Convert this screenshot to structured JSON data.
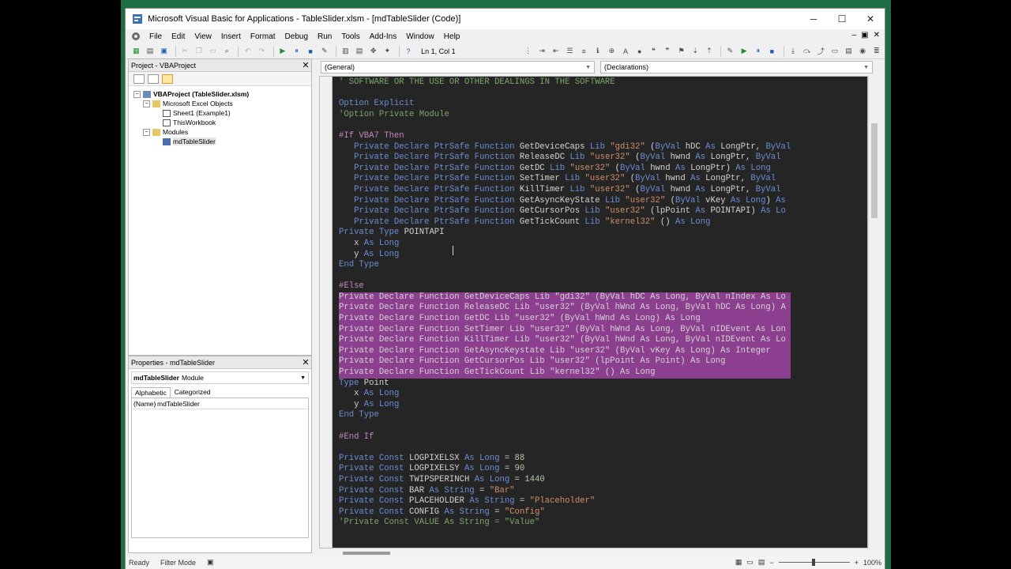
{
  "window": {
    "title": "Microsoft Visual Basic for Applications - TableSlider.xlsm - [mdTableSlider (Code)]",
    "minimize": "─",
    "maximize": "☐",
    "close": "✕"
  },
  "menu": [
    "File",
    "Edit",
    "View",
    "Insert",
    "Format",
    "Debug",
    "Run",
    "Tools",
    "Add-Ins",
    "Window",
    "Help"
  ],
  "mdi_buttons": [
    "–",
    "▣",
    "✕"
  ],
  "toolbar": {
    "position": "Ln 1, Col 1"
  },
  "project": {
    "title": "Project - VBAProject",
    "close": "✕",
    "tree": [
      {
        "label": "VBAProject (TableSlider.xlsm)",
        "level": 0,
        "exp": "−",
        "icon": "proj",
        "bold": true
      },
      {
        "label": "Microsoft Excel Objects",
        "level": 1,
        "exp": "−",
        "icon": "folder"
      },
      {
        "label": "Sheet1 (Example1)",
        "level": 2,
        "icon": "sheet"
      },
      {
        "label": "ThisWorkbook",
        "level": 2,
        "icon": "sheet"
      },
      {
        "label": "Modules",
        "level": 1,
        "exp": "−",
        "icon": "folder"
      },
      {
        "label": "mdTableSlider",
        "level": 2,
        "icon": "module",
        "selected": true
      }
    ]
  },
  "properties": {
    "title": "Properties - mdTableSlider",
    "close": "✕",
    "object_name": "mdTableSlider",
    "object_type": "Module",
    "tabs": [
      "Alphabetic",
      "Categorized"
    ],
    "rows": [
      {
        "key": "(Name)",
        "value": "mdTableSlider"
      }
    ]
  },
  "code_combos": {
    "general": "(General)",
    "declarations": "(Declarations)"
  },
  "code_lines": [
    {
      "h": "<span class=\"cm\">' SOFTWARE OR THE USE OR OTHER DEALINGS IN THE SOFTWARE</span>"
    },
    {
      "h": ""
    },
    {
      "h": "<span class=\"k\">Option Explicit</span>"
    },
    {
      "h": "<span class=\"cm\">'Option Private Module</span>"
    },
    {
      "h": ""
    },
    {
      "h": "<span class=\"pp\">#If VBA7 Then</span>"
    },
    {
      "h": "   <span class=\"k\">Private Declare PtrSafe Function</span> GetDeviceCaps <span class=\"k\">Lib</span> <span class=\"s\">\"gdi32\"</span> (<span class=\"k\">ByVal</span> hDC <span class=\"k\">As</span> LongPtr, <span class=\"k\">ByVal</span>"
    },
    {
      "h": "   <span class=\"k\">Private Declare PtrSafe Function</span> ReleaseDC <span class=\"k\">Lib</span> <span class=\"s\">\"user32\"</span> (<span class=\"k\">ByVal</span> hwnd <span class=\"k\">As</span> LongPtr, <span class=\"k\">ByVal</span>"
    },
    {
      "h": "   <span class=\"k\">Private Declare PtrSafe Function</span> GetDC <span class=\"k\">Lib</span> <span class=\"s\">\"user32\"</span> (<span class=\"k\">ByVal</span> hwnd <span class=\"k\">As</span> LongPtr) <span class=\"k\">As Long</span>"
    },
    {
      "h": "   <span class=\"k\">Private Declare PtrSafe Function</span> SetTimer <span class=\"k\">Lib</span> <span class=\"s\">\"user32\"</span> (<span class=\"k\">ByVal</span> hwnd <span class=\"k\">As</span> LongPtr, <span class=\"k\">ByVal</span>"
    },
    {
      "h": "   <span class=\"k\">Private Declare PtrSafe Function</span> KillTimer <span class=\"k\">Lib</span> <span class=\"s\">\"user32\"</span> (<span class=\"k\">ByVal</span> hwnd <span class=\"k\">As</span> LongPtr, <span class=\"k\">ByVal</span>"
    },
    {
      "h": "   <span class=\"k\">Private Declare PtrSafe Function</span> GetAsyncKeyState <span class=\"k\">Lib</span> <span class=\"s\">\"user32\"</span> (<span class=\"k\">ByVal</span> vKey <span class=\"k\">As Long</span>) <span class=\"k\">As</span>"
    },
    {
      "h": "   <span class=\"k\">Private Declare PtrSafe Function</span> GetCursorPos <span class=\"k\">Lib</span> <span class=\"s\">\"user32\"</span> (lpPoint <span class=\"k\">As</span> POINTAPI) <span class=\"k\">As Lo</span>"
    },
    {
      "h": "   <span class=\"k\">Private Declare PtrSafe Function</span> GetTickCount <span class=\"k\">Lib</span> <span class=\"s\">\"kernel32\"</span> () <span class=\"k\">As Long</span>"
    },
    {
      "h": "<span class=\"k\">Private Type</span> POINTAPI"
    },
    {
      "h": "   x <span class=\"k\">As Long</span>"
    },
    {
      "h": "   y <span class=\"k\">As Long</span>"
    },
    {
      "h": "<span class=\"k\">End Type</span>"
    },
    {
      "h": ""
    },
    {
      "h": "<span class=\"pp\">#Else</span>"
    },
    {
      "h": "Private Declare Function GetDeviceCaps Lib \"gdi32\" (ByVal hDC As Long, ByVal nIndex As Lo",
      "hl": true
    },
    {
      "h": "Private Declare Function ReleaseDC Lib \"user32\" (ByVal hWnd As Long, ByVal hDC As Long) A",
      "hl": true
    },
    {
      "h": "Private Declare Function GetDC Lib \"user32\" (ByVal hWnd As Long) As Long",
      "hl": true
    },
    {
      "h": "Private Declare Function SetTimer Lib \"user32\" (ByVal hWnd As Long, ByVal nIDEvent As Lon",
      "hl": true
    },
    {
      "h": "Private Declare Function KillTimer Lib \"user32\" (ByVal hWnd As Long, ByVal nIDEvent As Lo",
      "hl": true
    },
    {
      "h": "Private Declare Function GetAsyncKeystate Lib \"user32\" (ByVal vKey As Long) As Integer",
      "hl": true
    },
    {
      "h": "Private Declare Function GetCursorPos Lib \"user32\" (lpPoint As Point) As Long",
      "hl": true
    },
    {
      "h": "Private Declare Function GetTickCount Lib \"kernel32\" () As Long",
      "hl": true
    },
    {
      "h": "<span class=\"k\">Type</span> Point"
    },
    {
      "h": "   x <span class=\"k\">As Long</span>"
    },
    {
      "h": "   y <span class=\"k\">As Long</span>"
    },
    {
      "h": "<span class=\"k\">End Type</span>"
    },
    {
      "h": ""
    },
    {
      "h": "<span class=\"pp\">#End If</span>"
    },
    {
      "h": ""
    },
    {
      "h": "<span class=\"k\">Private Const</span> LOGPIXELSX <span class=\"k\">As Long</span> = <span class=\"n\">88</span>"
    },
    {
      "h": "<span class=\"k\">Private Const</span> LOGPIXELSY <span class=\"k\">As Long</span> = <span class=\"n\">90</span>"
    },
    {
      "h": "<span class=\"k\">Private Const</span> TWIPSPERINCH <span class=\"k\">As Long</span> = <span class=\"n\">1440</span>"
    },
    {
      "h": "<span class=\"k\">Private Const</span> BAR <span class=\"k\">As String</span> = <span class=\"s\">\"Bar\"</span>"
    },
    {
      "h": "<span class=\"k\">Private Const</span> PLACEHOLDER <span class=\"k\">As String</span> = <span class=\"s\">\"Placeholder\"</span>"
    },
    {
      "h": "<span class=\"k\">Private Const</span> CONFIG <span class=\"k\">As String</span> = <span class=\"s\">\"Config\"</span>"
    },
    {
      "h": "<span class=\"cm\">'Private Const VALUE As String = \"Value\"</span>"
    }
  ],
  "status": {
    "ready": "Ready",
    "mode": "Filter Mode",
    "zoom": "100%"
  },
  "colors": {
    "excel_green": "#1e6e43",
    "code_bg": "#252525",
    "selection": "#8c3f8e"
  }
}
